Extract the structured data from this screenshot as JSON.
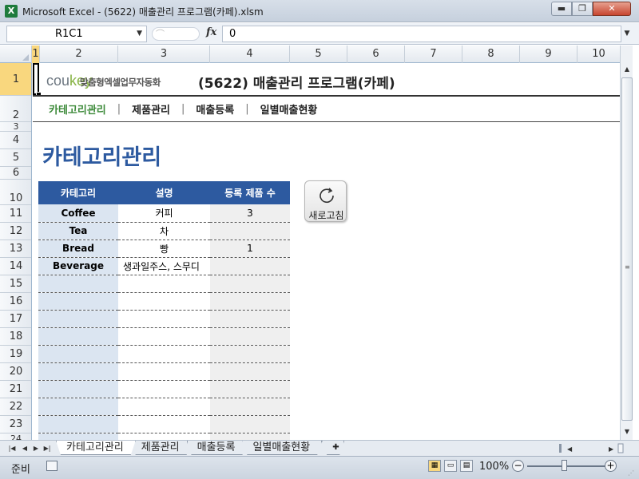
{
  "window": {
    "title": "Microsoft Excel - (5622) 매출관리 프로그램(카페).xlsm",
    "app_icon": "X",
    "min_label": "▬",
    "max_label": "❐",
    "close_label": "✕"
  },
  "formula_bar": {
    "name_box": "R1C1",
    "fx_label": "fx",
    "formula": "0"
  },
  "columns": [
    "1",
    "2",
    "3",
    "4",
    "5",
    "6",
    "7",
    "8",
    "9",
    "10"
  ],
  "rows": [
    "1",
    "2",
    "3",
    "4",
    "5",
    "6",
    "10",
    "11",
    "12",
    "13",
    "14",
    "15",
    "16",
    "17",
    "18",
    "19",
    "20",
    "21",
    "22",
    "23",
    "24"
  ],
  "sheet": {
    "logo_main": "cou",
    "logo_key": "key",
    "logo_sub": "맞춤형엑셀업무자동화",
    "title": "(5622) 매출관리 프로그램(카페)",
    "nav": [
      "카테고리관리",
      "제품관리",
      "매출등록",
      "일별매출현황"
    ],
    "section_title": "카테고리관리",
    "table_headers": [
      "카테고리",
      "설명",
      "등록 제품 수"
    ],
    "table_rows": [
      [
        "Coffee",
        "커피",
        "3"
      ],
      [
        "Tea",
        "차",
        ""
      ],
      [
        "Bread",
        "빵",
        "1"
      ],
      [
        "Beverage",
        "생과일주스, 스무디",
        ""
      ],
      [
        "",
        "",
        ""
      ],
      [
        "",
        "",
        ""
      ],
      [
        "",
        "",
        ""
      ],
      [
        "",
        "",
        ""
      ],
      [
        "",
        "",
        ""
      ],
      [
        "",
        "",
        ""
      ],
      [
        "",
        "",
        ""
      ],
      [
        "",
        "",
        ""
      ],
      [
        "",
        "",
        ""
      ],
      [
        "",
        "",
        ""
      ]
    ],
    "refresh_label": "새로고침"
  },
  "tabs": [
    "카테고리관리",
    "제품관리",
    "매출등록",
    "일별매출현황"
  ],
  "active_tab": 0,
  "status": {
    "text": "준비",
    "zoom": "100%"
  },
  "colors": {
    "accent_blue": "#2d5aa0",
    "nav_active_green": "#3d8a3a",
    "category_cell": "#dbe5f1",
    "count_cell": "#efefef",
    "excel_green": "#1e7b3c"
  },
  "icons": [
    "excel-icon",
    "refresh-icon",
    "fx-icon",
    "macro-record-icon",
    "new-sheet-icon"
  ]
}
